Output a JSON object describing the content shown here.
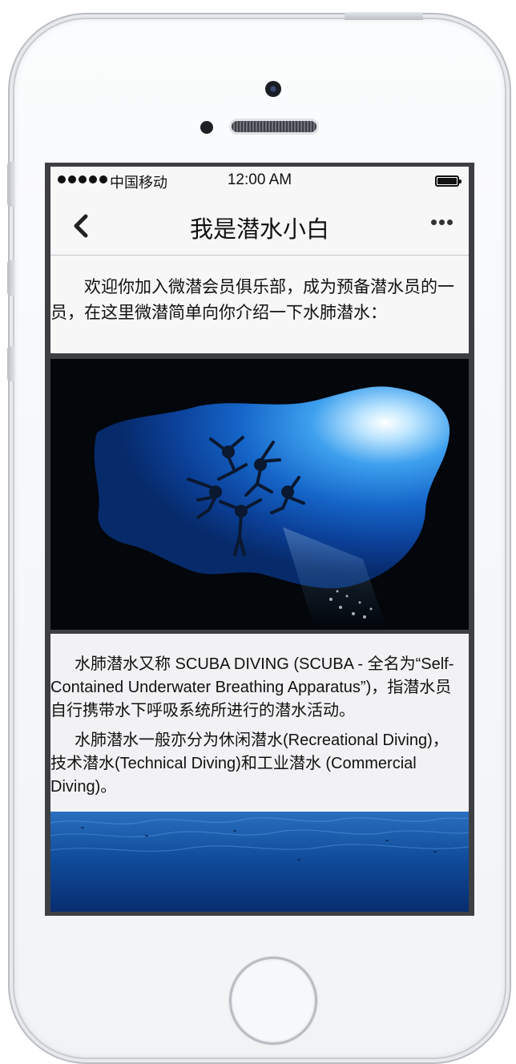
{
  "status_bar": {
    "carrier": "中国移动",
    "time": "12:00 AM"
  },
  "nav": {
    "title": "我是潜水小白"
  },
  "intro": {
    "text": "欢迎你加入微潜会员俱乐部，成为预备潜水员的一员，在这里微潜简单向你介绍一下水肺潜水："
  },
  "article": {
    "paragraphs": [
      "水肺潜水又称 SCUBA DIVING (SCUBA - 全名为“Self-Contained Underwater Breathing Apparatus”)，指潜水员自行携带水下呼吸系统所进行的潜水活动。",
      "水肺潜水一般亦分为休闲潜水(Recreational Diving)，技术潜水(Technical Diving)和工业潜水 (Commercial Diving)。"
    ]
  },
  "colors": {
    "screen_border": "#3e3f43",
    "nav_background": "#f7f7f8",
    "ocean_deep": "#0a3273",
    "ocean_light": "#4aa8f0"
  },
  "icons": [
    "back-chevron-icon",
    "more-dots-icon",
    "signal-dots-icon",
    "battery-icon"
  ]
}
